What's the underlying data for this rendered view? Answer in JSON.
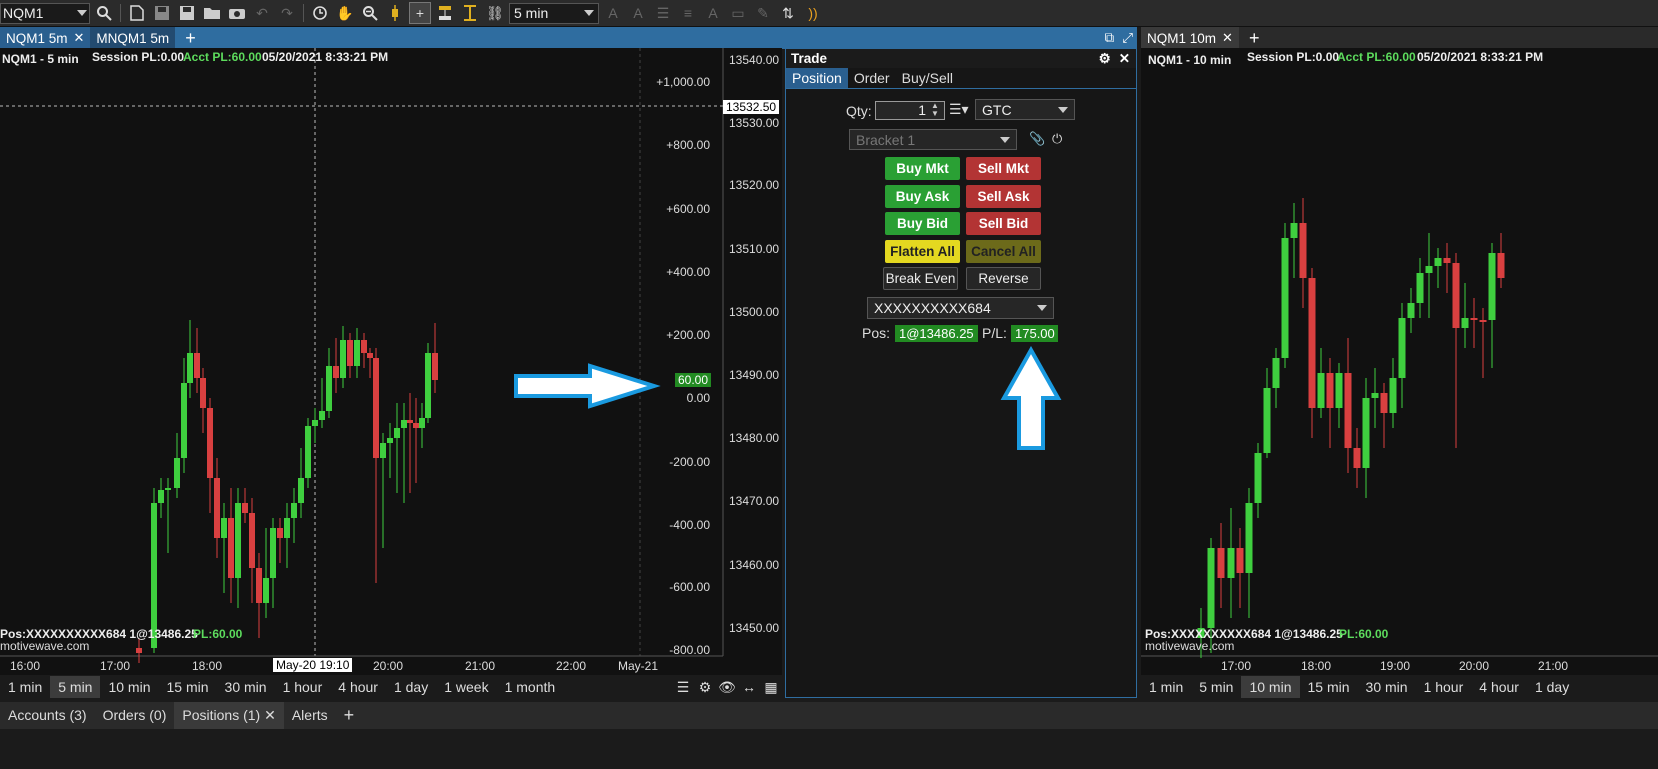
{
  "toolbar": {
    "symbol": "NQM1",
    "interval": "5 min",
    "icons": [
      "search-icon",
      "new-chart-icon",
      "save-icon",
      "save-all-icon",
      "open-folder-icon",
      "camera-icon",
      "undo-icon",
      "redo-icon",
      "clock-icon",
      "hand-icon",
      "zoom-icon",
      "candle-icon",
      "crosshair-icon",
      "bar-type-icon",
      "cursor-icon",
      "link-icon",
      "font-up-icon",
      "font-down-icon",
      "line-style-icon",
      "line-width-icon",
      "text-color-icon",
      "fill-color-icon",
      "pen-icon",
      "sort-icon",
      "rss-icon"
    ]
  },
  "left_tabs": [
    {
      "label": "NQM1 5m",
      "closable": true
    },
    {
      "label": "MNQM1 5m",
      "closable": false
    }
  ],
  "left_chart": {
    "title": "NQM1 - 5 min",
    "session_pl": "Session PL:0.00",
    "acct_pl": "Acct PL:60.00",
    "timestamp": "05/20/2021 8:33:21 PM",
    "pos_text": "Pos:XXXXXXXXXX684 1@13486.25",
    "pl_text": "PL:60.00",
    "watermark": "motivewave.com",
    "pl_axis": [
      "+1,000.00",
      "+800.00",
      "+600.00",
      "+400.00",
      "+200.00",
      "0.00",
      "-200.00",
      "-400.00",
      "-600.00",
      "-800.00"
    ],
    "pl_marker": "60.00",
    "price_axis": [
      "13540.00",
      "13530.00",
      "13520.00",
      "13510.00",
      "13500.00",
      "13490.00",
      "13480.00",
      "13470.00",
      "13460.00",
      "13450.00"
    ],
    "price_marker": "13532.50",
    "time_axis": [
      "16:00",
      "17:00",
      "18:00",
      "19:10",
      "20:00",
      "21:00",
      "22:00",
      "May-21"
    ],
    "time_marker": "May-20 19:10",
    "accent_green": "#5ddc5d",
    "candle_up": "#3fcf3f",
    "candle_down": "#d94040"
  },
  "left_timeframes": [
    {
      "label": "1 min",
      "selected": false
    },
    {
      "label": "5 min",
      "selected": true
    },
    {
      "label": "10 min",
      "selected": false
    },
    {
      "label": "15 min",
      "selected": false
    },
    {
      "label": "30 min",
      "selected": false
    },
    {
      "label": "1 hour",
      "selected": false
    },
    {
      "label": "4 hour",
      "selected": false
    },
    {
      "label": "1 day",
      "selected": false
    },
    {
      "label": "1 week",
      "selected": false
    },
    {
      "label": "1 month",
      "selected": false
    }
  ],
  "trade": {
    "title": "Trade",
    "tabs": [
      "Position",
      "Order",
      "Buy/Sell"
    ],
    "qty_label": "Qty:",
    "qty_value": "1",
    "tif": "GTC",
    "bracket": "Bracket 1",
    "buy_mkt": "Buy Mkt",
    "sell_mkt": "Sell Mkt",
    "buy_ask": "Buy Ask",
    "sell_ask": "Sell Ask",
    "buy_bid": "Buy Bid",
    "sell_bid": "Sell Bid",
    "flatten": "Flatten All",
    "cancel_all": "Cancel All",
    "break_even": "Break Even",
    "reverse": "Reverse",
    "account": "XXXXXXXXXX684",
    "pos_label": "Pos:",
    "pos_value": "1@13486.25",
    "pl_label": "P/L:",
    "pl_value": "175.00"
  },
  "right_tabs": [
    {
      "label": "NQM1 10m",
      "closable": true
    }
  ],
  "right_chart": {
    "title": "NQM1 - 10 min",
    "session_pl": "Session PL:0.00",
    "acct_pl": "Acct PL:60.00",
    "timestamp": "05/20/2021 8:33:21 PM",
    "pos_text": "Pos:XXXXXXXXXX684 1@13486.25",
    "pl_text": "PL:60.00",
    "watermark": "motivewave.com",
    "time_axis": [
      "17:00",
      "18:00",
      "19:00",
      "20:00",
      "21:00"
    ]
  },
  "right_timeframes": [
    {
      "label": "1 min",
      "selected": false
    },
    {
      "label": "5 min",
      "selected": false
    },
    {
      "label": "10 min",
      "selected": true
    },
    {
      "label": "15 min",
      "selected": false
    },
    {
      "label": "30 min",
      "selected": false
    },
    {
      "label": "1 hour",
      "selected": false
    },
    {
      "label": "4 hour",
      "selected": false
    },
    {
      "label": "1 day",
      "selected": false
    }
  ],
  "bottom_tabs": [
    {
      "label": "Accounts (3)",
      "selected": false,
      "closable": false
    },
    {
      "label": "Orders (0)",
      "selected": false,
      "closable": false
    },
    {
      "label": "Positions (1)",
      "selected": true,
      "closable": true
    },
    {
      "label": "Alerts",
      "selected": false,
      "closable": false
    }
  ]
}
